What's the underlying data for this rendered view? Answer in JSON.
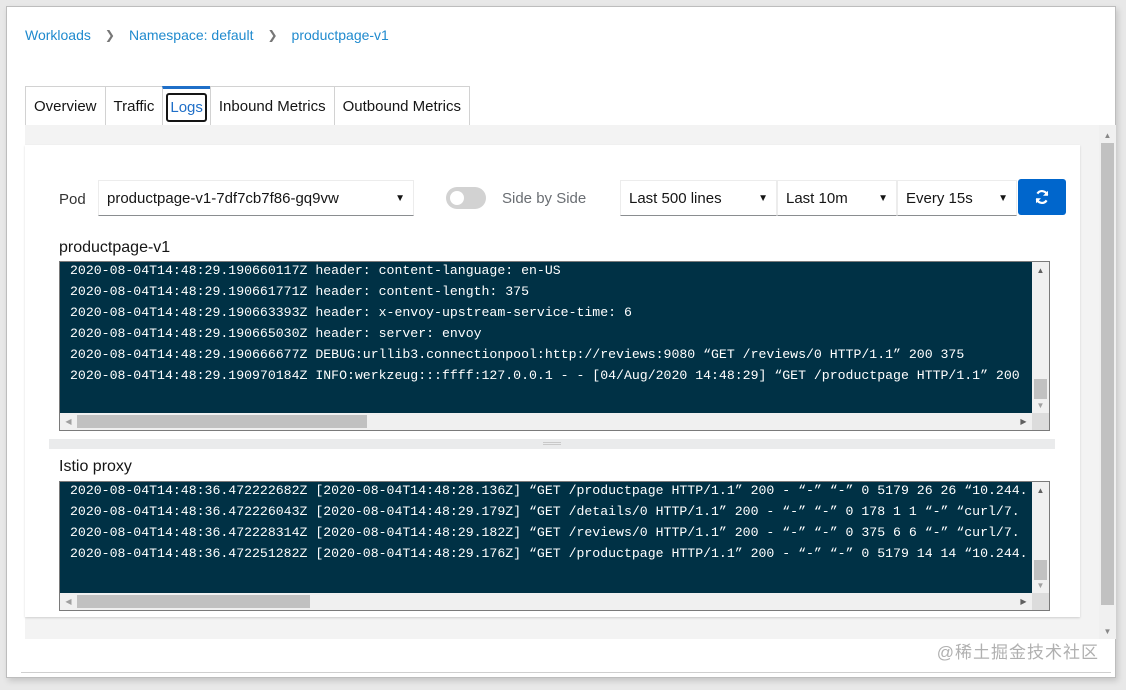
{
  "breadcrumb": [
    {
      "label": "Workloads"
    },
    {
      "label": "Namespace: default"
    },
    {
      "label": "productpage-v1"
    }
  ],
  "tabs": [
    {
      "label": "Overview",
      "active": false
    },
    {
      "label": "Traffic",
      "active": false
    },
    {
      "label": "Logs",
      "active": true
    },
    {
      "label": "Inbound Metrics",
      "active": false
    },
    {
      "label": "Outbound Metrics",
      "active": false
    }
  ],
  "toolbar": {
    "pod_label": "Pod",
    "pod_value": "productpage-v1-7df7cb7f86-gq9vw",
    "side_by_side_label": "Side by Side",
    "side_by_side_on": false,
    "lines_value": "Last 500 lines",
    "time_value": "Last 10m",
    "refresh_interval_value": "Every 15s",
    "refresh_icon": "sync-icon",
    "accent_color": "#0066cc"
  },
  "app_logs": {
    "title": "productpage-v1",
    "lines": [
      "2020-08-04T14:48:29.190660117Z header: content-language: en-US",
      "2020-08-04T14:48:29.190661771Z header: content-length: 375",
      "2020-08-04T14:48:29.190663393Z header: x-envoy-upstream-service-time: 6",
      "2020-08-04T14:48:29.190665030Z header: server: envoy",
      "2020-08-04T14:48:29.190666677Z DEBUG:urllib3.connectionpool:http://reviews:9080 “GET /reviews/0 HTTP/1.1” 200 375",
      "2020-08-04T14:48:29.190970184Z INFO:werkzeug:::ffff:127.0.0.1 - - [04/Aug/2020 14:48:29] “GET /productpage HTTP/1.1” 200"
    ]
  },
  "proxy_logs": {
    "title": "Istio proxy",
    "lines": [
      "2020-08-04T14:48:36.472222682Z [2020-08-04T14:48:28.136Z] “GET /productpage HTTP/1.1” 200 - “-” “-” 0 5179 26 26 “10.244.",
      "2020-08-04T14:48:36.472226043Z [2020-08-04T14:48:29.179Z] “GET /details/0 HTTP/1.1” 200 - “-” “-” 0 178 1 1 “-” “curl/7.",
      "2020-08-04T14:48:36.472228314Z [2020-08-04T14:48:29.182Z] “GET /reviews/0 HTTP/1.1” 200 - “-” “-” 0 375 6 6 “-” “curl/7.",
      "2020-08-04T14:48:36.472251282Z [2020-08-04T14:48:29.176Z] “GET /productpage HTTP/1.1” 200 - “-” “-” 0 5179 14 14 “10.244."
    ]
  },
  "watermark": "@稀土掘金技术社区"
}
